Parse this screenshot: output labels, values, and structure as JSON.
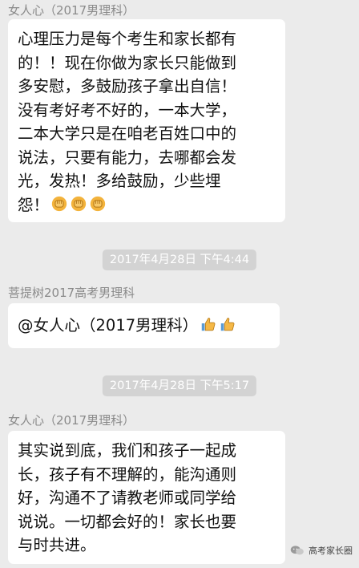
{
  "messages": [
    {
      "sender": "女人心（2017男理科）",
      "text": "心理压力是每个考生和家长都有\n的！！现在你做为家长只能做到\n多安慰，多鼓励孩子拿出自信！\n没有考好考不好的，一本大学，\n二本大学只是在咱老百姓口中的\n说法，只要有能力，去哪都会发\n光，发热！多给鼓励，少些埋\n怨！",
      "emojis": [
        "fist-emoji",
        "fist-emoji",
        "fist-emoji"
      ]
    },
    {
      "timestamp": "2017年4月28日 下午4:44"
    },
    {
      "sender": "菩提树2017高考男理科",
      "text": "@女人心（2017男理科）",
      "emojis": [
        "thumbs-up-emoji",
        "thumbs-up-emoji"
      ]
    },
    {
      "timestamp": "2017年4月28日 下午5:17"
    },
    {
      "sender": "女人心（2017男理科）",
      "text": "其实说到底，我们和孩子一起成\n长，孩子有不理解的，能沟通则\n好，沟通不了请教老师或同学给\n说说。一切都会好的！家长也要\n与时共进。",
      "emojis": []
    }
  ],
  "watermark": {
    "icon": "wechat-icon",
    "label": "高考家长圈"
  },
  "colors": {
    "background": "#ebebeb",
    "bubble": "#ffffff",
    "timestamp_pill": "#d3d3d3",
    "sender_text": "#8a8a8a"
  }
}
